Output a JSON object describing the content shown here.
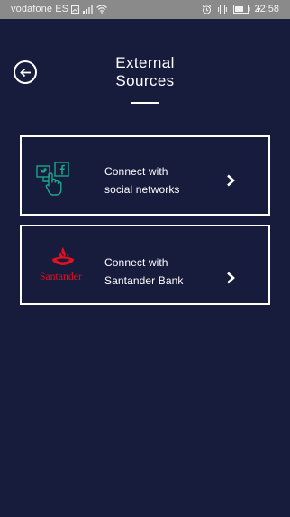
{
  "status_bar": {
    "carrier": "vodafone ES",
    "time": "22:58",
    "icons": [
      "image-icon",
      "signal-icon",
      "wifi-icon",
      "alarm-icon",
      "vibrate-icon",
      "battery-icon",
      "charging-icon"
    ]
  },
  "header": {
    "back_icon": "arrow-left-icon",
    "title_line1": "External",
    "title_line2": "Sources"
  },
  "cards": [
    {
      "id": "social",
      "icon": "social-touch-icon",
      "label_line1": "Connect with",
      "label_line2": "social networks",
      "chevron": "chevron-right-icon"
    },
    {
      "id": "bank",
      "icon": "santander-logo",
      "logo_text": "Santander",
      "label_line1": "Connect with",
      "label_line2": "Santander Bank",
      "chevron": "chevron-right-icon"
    }
  ],
  "colors": {
    "background": "#181c3c",
    "status_bar": "#8a8a8a",
    "accent_green": "#1aa68a",
    "santander_red": "#e3111e",
    "border": "#ffffff"
  }
}
